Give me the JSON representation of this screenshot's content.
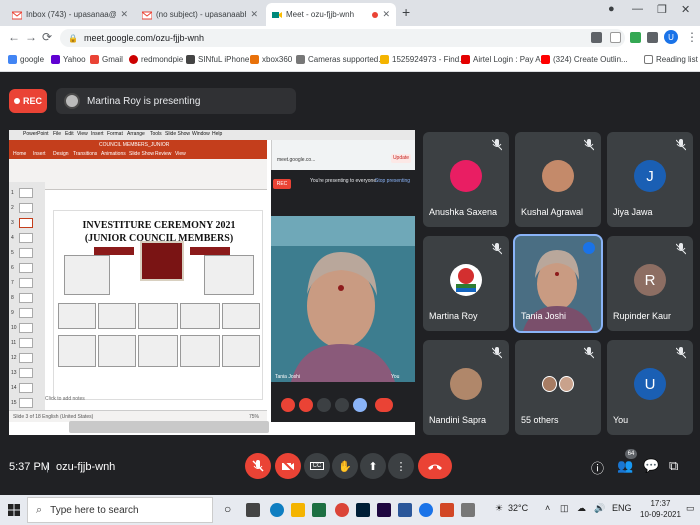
{
  "browser": {
    "tabs": [
      {
        "title": "Inbox (743) - upasanaa@theindi",
        "favicon_color": "#ea4335",
        "active": false
      },
      {
        "title": "(no subject) - upasanaabhalla13",
        "favicon_color": "#ea4335",
        "active": false
      },
      {
        "title": "Meet - ozu-fjjb-wnh",
        "favicon_color": "#00897b",
        "active": true
      }
    ],
    "new_tab": "+",
    "window_controls": [
      "—",
      "❐",
      "✕"
    ],
    "address": "meet.google.com/ozu-fjjb-wnh",
    "profile_initial": "U",
    "bookmarks": [
      {
        "label": "google",
        "color": "#4285f4"
      },
      {
        "label": "Yahoo",
        "color": "#6001d2"
      },
      {
        "label": "Gmail",
        "color": "#ea4335"
      },
      {
        "label": "redmondpie",
        "color": "#c00"
      },
      {
        "label": "SINfuL iPhone",
        "color": "#444"
      },
      {
        "label": "xbox360",
        "color": "#e8710a"
      },
      {
        "label": "Cameras supported...",
        "color": "#777"
      },
      {
        "label": "1525924973 - Find...",
        "color": "#f4b400"
      },
      {
        "label": "Airtel Login : Pay Al...",
        "color": "#e40000"
      },
      {
        "label": "(324) Create Outlin...",
        "color": "#ff0000"
      }
    ],
    "reading_list": "Reading list"
  },
  "meet": {
    "rec_label": "REC",
    "presenter_banner": "Martina Roy is presenting",
    "presentation": {
      "app_menu": [
        "PowerPoint",
        "File",
        "Edit",
        "View",
        "Insert",
        "Format",
        "Arrange",
        "Tools",
        "Slide Show",
        "Window",
        "Help"
      ],
      "file_name": "COUNCIL MEMBERS_JUNIOR",
      "ribbon_tabs": [
        "Home",
        "Insert",
        "Design",
        "Transitions",
        "Animations",
        "Slide Show",
        "Review",
        "View"
      ],
      "slide_title": "INVESTITURE CEREMONY 2021",
      "slide_subtitle": "(JUNIOR COUNCIL MEMBERS)",
      "notes": "Click to add notes",
      "status": "Slide 3 of 18    English (United States)",
      "zoom": "75%",
      "thumb_numbers": [
        "1",
        "2",
        "3",
        "4",
        "5",
        "6",
        "7",
        "8",
        "9",
        "10",
        "11",
        "12",
        "13",
        "14",
        "15"
      ],
      "mini_url": "meet.google.co...",
      "mini_presenting": "You're presenting to everyone",
      "mini_stop": "Stop presenting",
      "mini_rec": "REC",
      "mini_self_name": "Tania Joshi",
      "mini_you": "You",
      "update_label": "Update"
    },
    "participants": [
      {
        "name": "Anushka Saxena",
        "type": "avatar",
        "color": "#e91e63",
        "initial": ""
      },
      {
        "name": "Kushal Agrawal",
        "type": "photo",
        "color": "#c48a6a",
        "initial": ""
      },
      {
        "name": "Jiya Jawa",
        "type": "avatar",
        "color": "#1a5fb4",
        "initial": "J"
      },
      {
        "name": "Martina Roy",
        "type": "photo",
        "color": "#d32f2f",
        "initial": ""
      },
      {
        "name": "Tania Joshi",
        "type": "video",
        "color": "#4a6e83",
        "initial": ""
      },
      {
        "name": "Rupinder Kaur",
        "type": "avatar",
        "color": "#8d6e63",
        "initial": "R"
      },
      {
        "name": "Nandini Sapra",
        "type": "photo",
        "color": "#b0876a",
        "initial": ""
      },
      {
        "name": "55 others",
        "type": "group",
        "color": "#a67c63",
        "initial": ""
      },
      {
        "name": "You",
        "type": "avatar",
        "color": "#1a5fb4",
        "initial": "U"
      }
    ],
    "time": "5:37 PM",
    "separator": "|",
    "meeting_code": "ozu-fjjb-wnh",
    "participant_count": "64"
  },
  "taskbar": {
    "search_placeholder": "Type here to search",
    "weather": "32°C",
    "language": "ENG",
    "clock_time": "17:37",
    "clock_date": "10-09-2021"
  }
}
